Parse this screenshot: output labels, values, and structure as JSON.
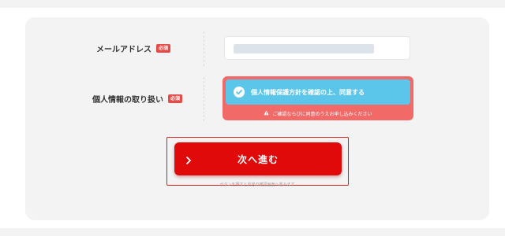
{
  "form": {
    "email": {
      "label": "メールアドレス",
      "required_badge": "必須",
      "value": ""
    },
    "privacy": {
      "label": "個人情報の取り扱い",
      "required_badge": "必須",
      "consent_button_label": "個人情報保護方針を確認の上、同意する",
      "warning_text": "ご確認ならびに同意のうえお申し込みください"
    },
    "next_button_label": "次へ進む",
    "fineprint": "ボタンを押すと内容の確認画面へ進みます"
  },
  "icons": {
    "check": "check-circle-icon",
    "warning": "warning-icon",
    "chevron": "chevron-right-icon"
  },
  "colors": {
    "required_badge": "#e74a47",
    "consent_button": "#5bc6ea",
    "consent_error_frame": "#f26a68",
    "primary_button": "#e00a0a"
  }
}
